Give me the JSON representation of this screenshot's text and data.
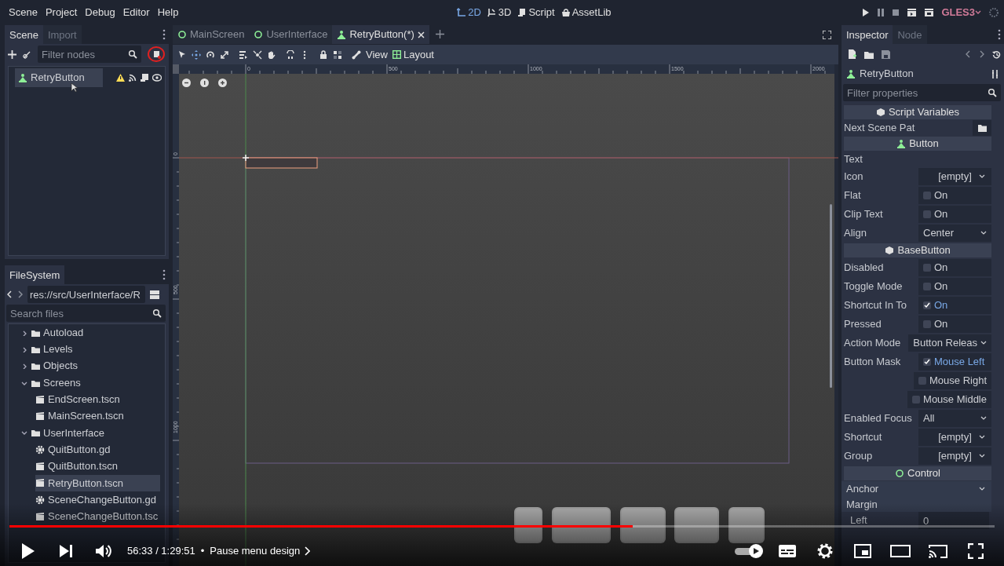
{
  "menu": [
    "Scene",
    "Project",
    "Debug",
    "Editor",
    "Help"
  ],
  "workspaces": [
    {
      "label": "2D",
      "selected": true,
      "kind": "plane"
    },
    {
      "label": "3D",
      "selected": false,
      "kind": "space"
    },
    {
      "label": "Script",
      "selected": false,
      "kind": "script"
    },
    {
      "label": "AssetLib",
      "selected": false,
      "kind": "assetlib"
    }
  ],
  "renderer": "GLES3",
  "scene_dock": {
    "tabs": [
      {
        "label": "Scene",
        "selected": true
      },
      {
        "label": "Import",
        "selected": false
      }
    ],
    "filter": {
      "placeholder": "Filter nodes"
    },
    "tree": [
      {
        "name": "RetryButton",
        "selected": true,
        "warning": true
      }
    ]
  },
  "filesystem": {
    "tab": "FileSystem",
    "path": "res://src/UserInterface/R",
    "search": {
      "placeholder": "Search files"
    },
    "tree": [
      {
        "name": "Autoload",
        "kind": "folder",
        "expanded": false,
        "selected": false
      },
      {
        "name": "Levels",
        "kind": "folder",
        "expanded": false,
        "selected": false
      },
      {
        "name": "Objects",
        "kind": "folder",
        "expanded": false,
        "selected": false
      },
      {
        "name": "Screens",
        "kind": "folder",
        "expanded": true,
        "selected": false,
        "children": [
          {
            "name": "EndScreen.tscn",
            "kind": "scene",
            "selected": false
          },
          {
            "name": "MainScreen.tscn",
            "kind": "scene",
            "selected": false
          }
        ]
      },
      {
        "name": "UserInterface",
        "kind": "folder",
        "expanded": true,
        "selected": false,
        "children": [
          {
            "name": "QuitButton.gd",
            "kind": "script",
            "selected": false
          },
          {
            "name": "QuitButton.tscn",
            "kind": "scene",
            "selected": false
          },
          {
            "name": "RetryButton.tscn",
            "kind": "scene",
            "selected": true
          },
          {
            "name": "SceneChangeButton.gd",
            "kind": "script",
            "selected": false
          },
          {
            "name": "SceneChangeButton.tsc",
            "kind": "scene",
            "selected": false
          }
        ]
      }
    ]
  },
  "editor_tabs": [
    {
      "label": "MainScreen",
      "selected": false,
      "kind": "control"
    },
    {
      "label": "UserInterface",
      "selected": false,
      "kind": "control"
    },
    {
      "label": "RetryButton(*)",
      "selected": true,
      "kind": "button"
    }
  ],
  "toolbar": {
    "view": "View",
    "layout": "Layout"
  },
  "rulers": {
    "x_labels": [
      "0",
      "500",
      "1000",
      "1500",
      "2000"
    ],
    "y_labels": [
      "0",
      "500",
      "1000"
    ]
  },
  "inspector": {
    "tabs": [
      {
        "label": "Inspector",
        "selected": true
      },
      {
        "label": "Node",
        "selected": false
      }
    ],
    "node": "RetryButton",
    "filter": {
      "placeholder": "Filter properties"
    },
    "properties": [
      {
        "kind": "section",
        "label": "Script Variables"
      },
      {
        "kind": "file",
        "label": "Next Scene Pat"
      },
      {
        "kind": "section",
        "label": "Button"
      },
      {
        "kind": "text",
        "label": "Text"
      },
      {
        "kind": "dropdown",
        "label": "Icon",
        "value": "[empty]"
      },
      {
        "kind": "check",
        "label": "Flat",
        "value": "On",
        "checked": false
      },
      {
        "kind": "check",
        "label": "Clip Text",
        "value": "On",
        "checked": false
      },
      {
        "kind": "dropdown",
        "label": "Align",
        "value": "Center"
      },
      {
        "kind": "section",
        "label": "BaseButton"
      },
      {
        "kind": "check",
        "label": "Disabled",
        "value": "On",
        "checked": false
      },
      {
        "kind": "check",
        "label": "Toggle Mode",
        "value": "On",
        "checked": false
      },
      {
        "kind": "check",
        "label": "Shortcut In To",
        "value": "On",
        "checked": true
      },
      {
        "kind": "check",
        "label": "Pressed",
        "value": "On",
        "checked": false
      },
      {
        "kind": "dropdown",
        "label": "Action Mode",
        "value": "Button Releas"
      },
      {
        "kind": "check",
        "label": "Button Mask",
        "value": "Mouse Left",
        "checked": true
      },
      {
        "kind": "check",
        "value": "Mouse Right",
        "checked": false
      },
      {
        "kind": "check",
        "value": "Mouse Middle",
        "checked": false
      },
      {
        "kind": "dropdown",
        "label": "Enabled Focus",
        "value": "All"
      },
      {
        "kind": "dropdown",
        "label": "Shortcut",
        "value": "[empty]"
      },
      {
        "kind": "dropdown",
        "label": "Group",
        "value": "[empty]"
      },
      {
        "kind": "section",
        "label": "Control"
      },
      {
        "kind": "group",
        "label": "Anchor"
      },
      {
        "kind": "group",
        "label": "Margin"
      },
      {
        "kind": "number",
        "label": "Left",
        "value": "0"
      }
    ]
  },
  "video": {
    "time": "56:33 / 1:29:51",
    "separator": "•",
    "chapter": "Pause menu design",
    "progress": {
      "level": 0.633
    }
  }
}
